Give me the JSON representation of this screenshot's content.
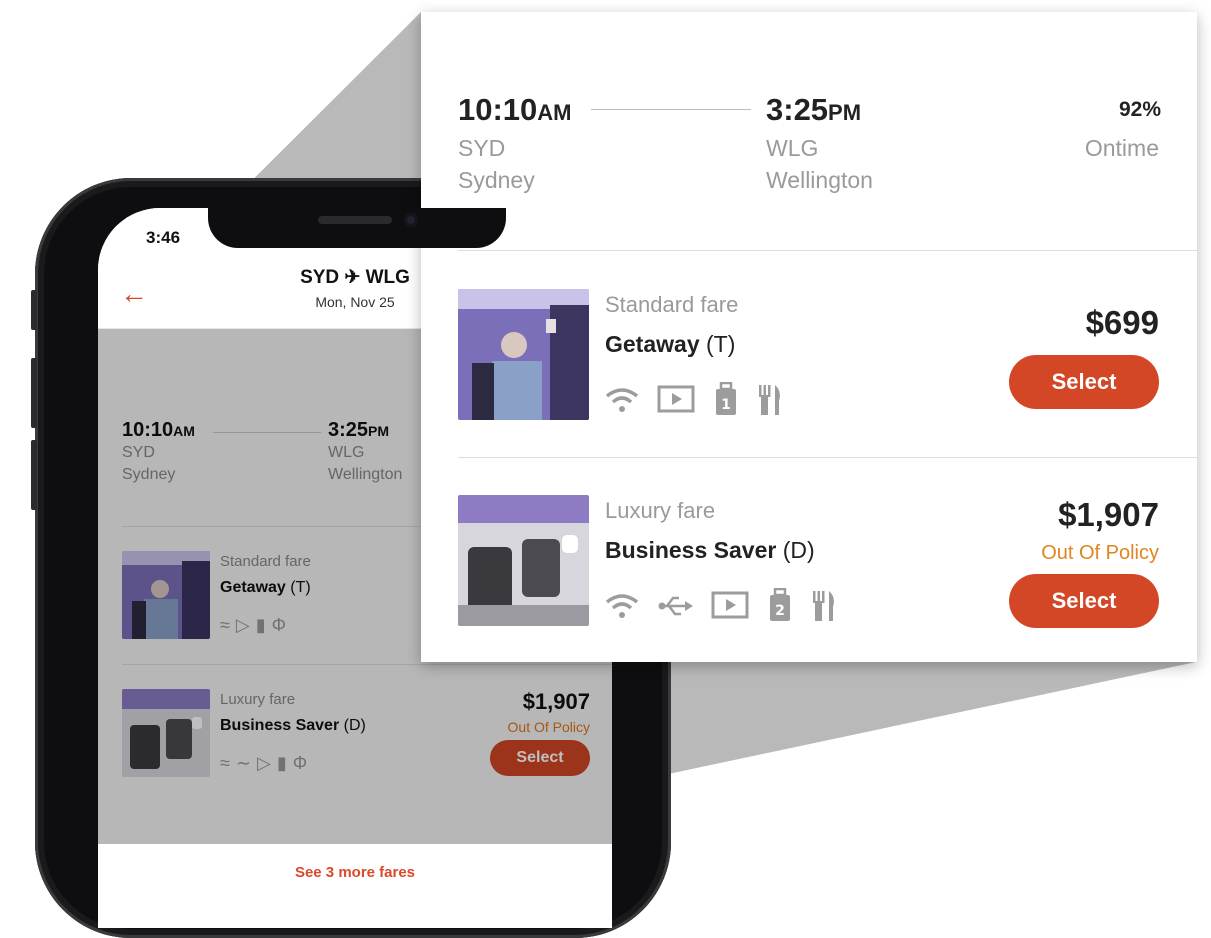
{
  "phone": {
    "status_time": "3:46",
    "header": {
      "route": "SYD ✈ WLG",
      "date": "Mon, Nov 25"
    },
    "flight": {
      "depart_time": "10:10",
      "depart_ampm": "AM",
      "depart_code": "SYD",
      "depart_city": "Sydney",
      "arrive_time": "3:25",
      "arrive_ampm": "PM",
      "arrive_code": "WLG",
      "arrive_city": "Wellington"
    },
    "fares": [
      {
        "label": "Standard fare",
        "name": "Getaway",
        "class_code": "(T)"
      },
      {
        "label": "Luxury fare",
        "name": "Business Saver",
        "class_code": "(D)",
        "price": "$1,907",
        "policy": "Out Of Policy",
        "select_label": "Select"
      }
    ],
    "more_fares": "See 3 more fares"
  },
  "callout": {
    "flight": {
      "depart_time": "10:10",
      "depart_ampm": "AM",
      "depart_code": "SYD",
      "depart_city": "Sydney",
      "arrive_time": "3:25",
      "arrive_ampm": "PM",
      "arrive_code": "WLG",
      "arrive_city": "Wellington",
      "ontime_pct": "92%",
      "ontime_label": "Ontime"
    },
    "fares": [
      {
        "label": "Standard fare",
        "name": "Getaway",
        "class_code": "(T)",
        "price": "$699",
        "select_label": "Select",
        "amenities": [
          "wifi-icon",
          "entertainment-icon",
          "bag-1-icon",
          "meal-icon"
        ]
      },
      {
        "label": "Luxury fare",
        "name": "Business Saver",
        "class_code": "(D)",
        "price": "$1,907",
        "policy": "Out Of Policy",
        "select_label": "Select",
        "amenities": [
          "wifi-icon",
          "usb-icon",
          "entertainment-icon",
          "bag-2-icon",
          "meal-icon"
        ]
      }
    ]
  },
  "colors": {
    "accent": "#d34727",
    "out_of_policy": "#e0851f",
    "muted_text": "#9a9a9a"
  }
}
